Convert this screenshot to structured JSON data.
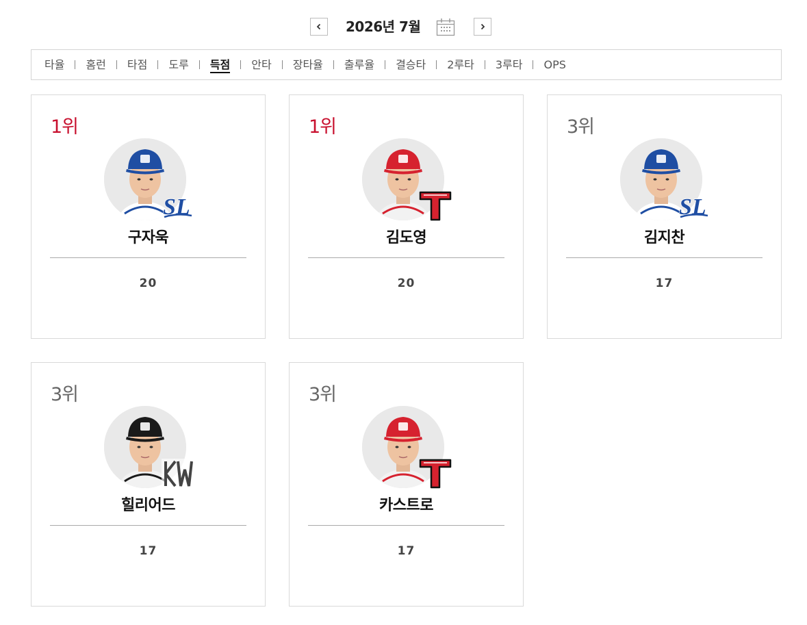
{
  "month_nav": {
    "title": "2026년 7월"
  },
  "tabs": [
    {
      "label": "타율",
      "active": false
    },
    {
      "label": "홈런",
      "active": false
    },
    {
      "label": "타점",
      "active": false
    },
    {
      "label": "도루",
      "active": false
    },
    {
      "label": "득점",
      "active": true
    },
    {
      "label": "안타",
      "active": false
    },
    {
      "label": "장타율",
      "active": false
    },
    {
      "label": "출루율",
      "active": false
    },
    {
      "label": "결승타",
      "active": false
    },
    {
      "label": "2루타",
      "active": false
    },
    {
      "label": "3루타",
      "active": false
    },
    {
      "label": "OPS",
      "active": false
    }
  ],
  "players": [
    {
      "rank": "1위",
      "name": "구자욱",
      "value": "20",
      "team": "samsung-lions-logo"
    },
    {
      "rank": "1위",
      "name": "김도영",
      "value": "20",
      "team": "kia-tigers-logo"
    },
    {
      "rank": "3위",
      "name": "김지찬",
      "value": "17",
      "team": "samsung-lions-logo"
    },
    {
      "rank": "3위",
      "name": "힐리어드",
      "value": "17",
      "team": "kt-wiz-logo"
    },
    {
      "rank": "3위",
      "name": "카스트로",
      "value": "17",
      "team": "kia-tigers-logo"
    }
  ],
  "colors": {
    "top_rank": "#c8102e",
    "rank": "#666666",
    "samsung_blue": "#1f4ea3",
    "kia_red": "#d6222f",
    "kt_black": "#1a1a1a"
  }
}
